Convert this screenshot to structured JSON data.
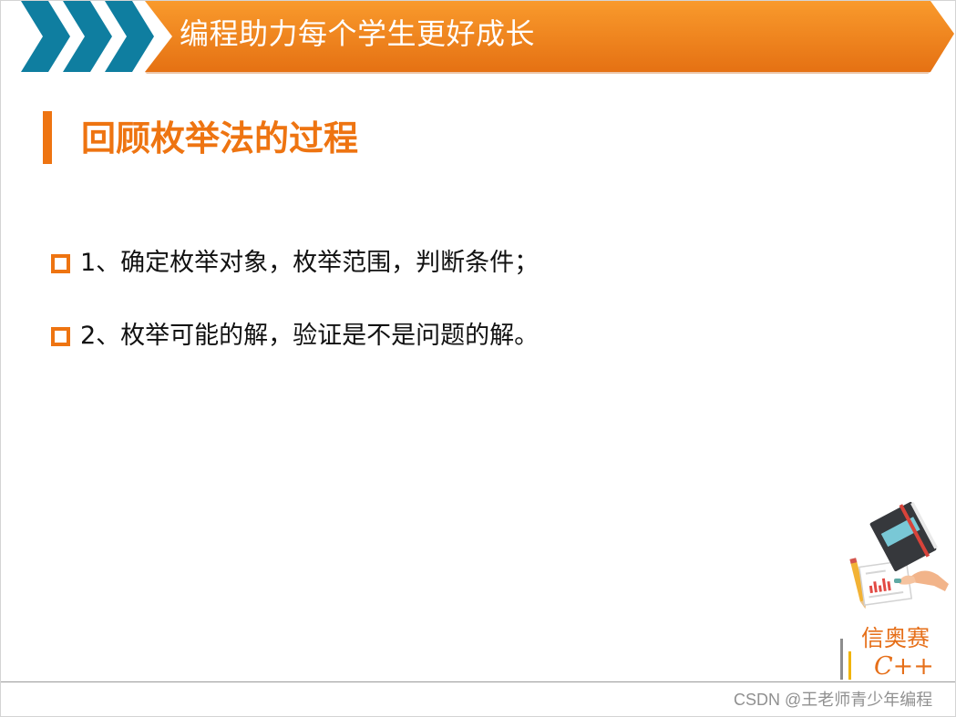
{
  "banner": {
    "title": "编程助力每个学生更好成长",
    "chevron_color": "#0f7ea0",
    "background_color": "#f0891f"
  },
  "slide": {
    "heading": "回顾枚举法的过程",
    "accent_color": "#ee7411",
    "bullets": [
      "1、确定枚举对象，枚举范围，判断条件；",
      "2、枚举可能的解，验证是不是问题的解。"
    ]
  },
  "logo": {
    "name": "信奥赛",
    "subtitle": "C++",
    "icon": "book-reading-icon"
  },
  "watermark": {
    "text": "CSDN @王老师青少年编程"
  }
}
